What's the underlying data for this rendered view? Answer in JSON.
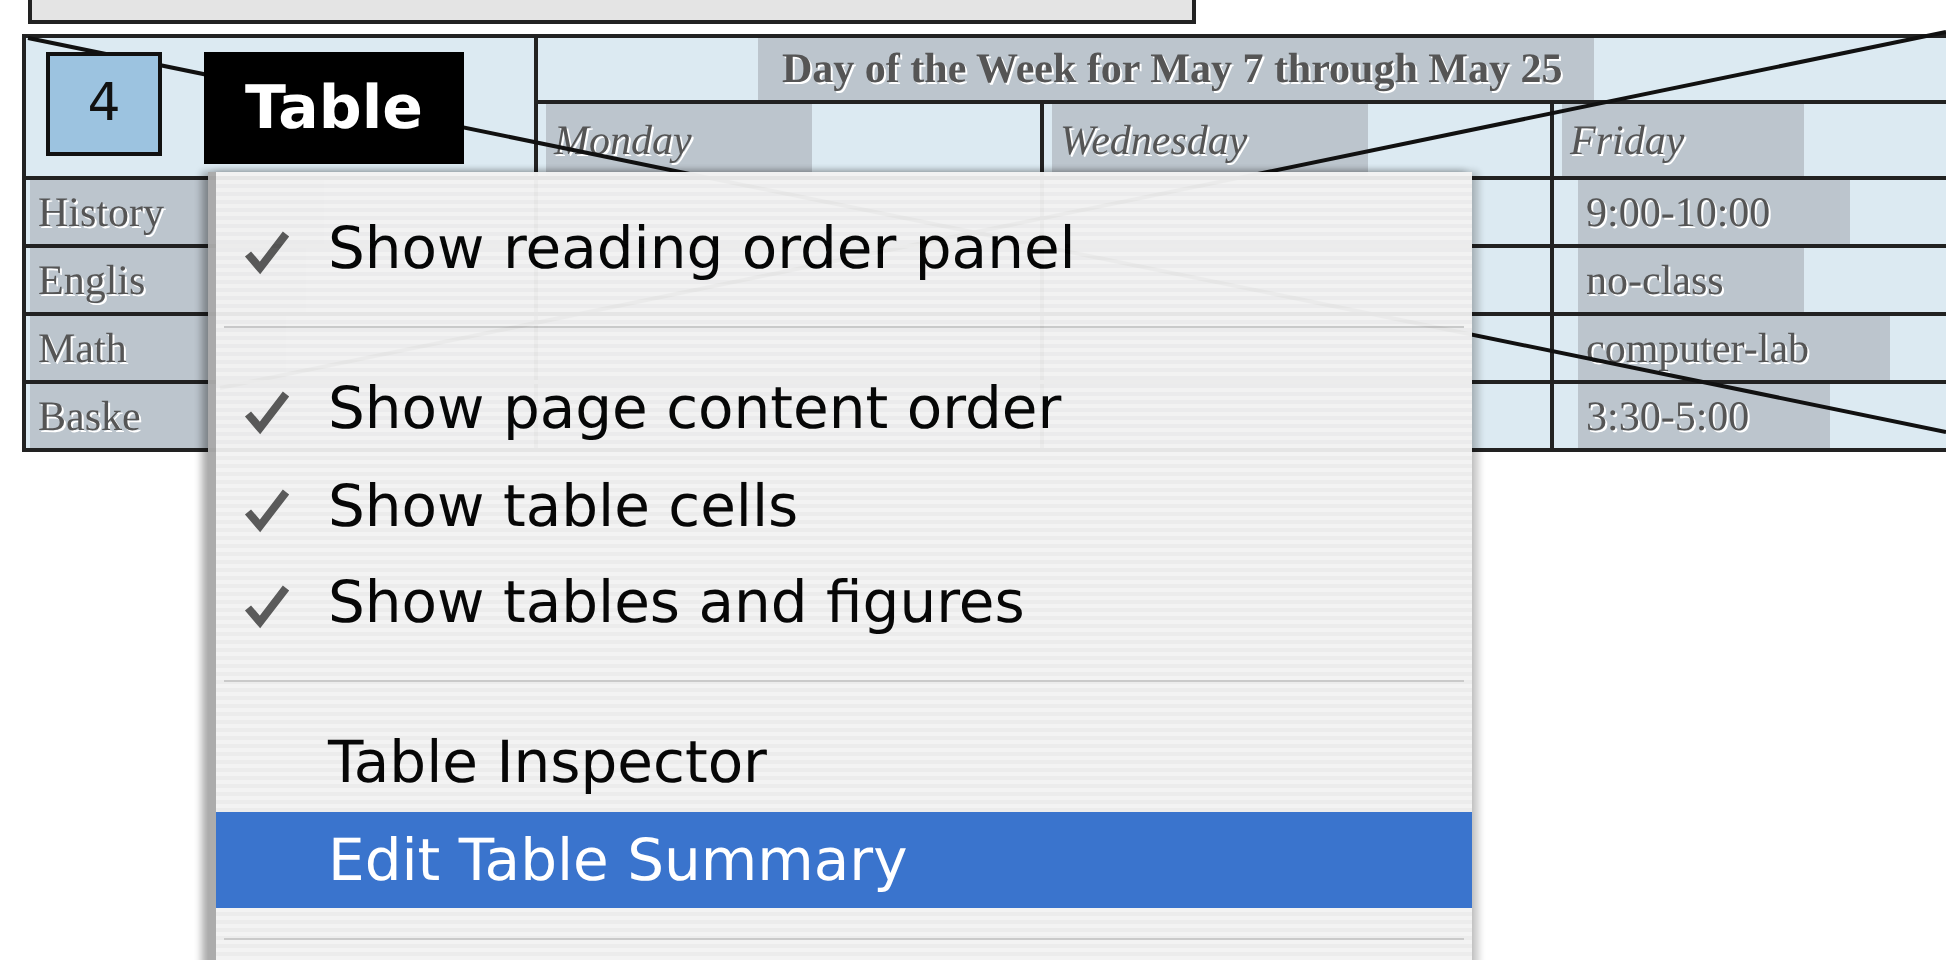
{
  "tag": {
    "number": "4",
    "label": "Table"
  },
  "table": {
    "header": "Day of the Week for May 7 through May 25",
    "columns": [
      "Monday",
      "Wednesday",
      "Friday"
    ],
    "rows": [
      {
        "label": "History",
        "friday": "9:00-10:00"
      },
      {
        "label": "Englis",
        "friday": "no-class"
      },
      {
        "label": "Math",
        "friday": "computer-lab"
      },
      {
        "label": "Baske",
        "friday": "3:30-5:00"
      }
    ]
  },
  "menu": {
    "items": [
      {
        "kind": "item",
        "label": "Show reading order panel",
        "checked": true,
        "selected": false
      },
      {
        "kind": "separator"
      },
      {
        "kind": "item",
        "label": "Show page content order",
        "checked": true,
        "selected": false
      },
      {
        "kind": "item",
        "label": "Show table cells",
        "checked": true,
        "selected": false
      },
      {
        "kind": "item",
        "label": "Show tables and figures",
        "checked": true,
        "selected": false
      },
      {
        "kind": "separator"
      },
      {
        "kind": "item",
        "label": "Table Inspector",
        "checked": false,
        "selected": false
      },
      {
        "kind": "item",
        "label": "Edit Table Summary",
        "checked": false,
        "selected": true
      },
      {
        "kind": "separator"
      }
    ]
  }
}
